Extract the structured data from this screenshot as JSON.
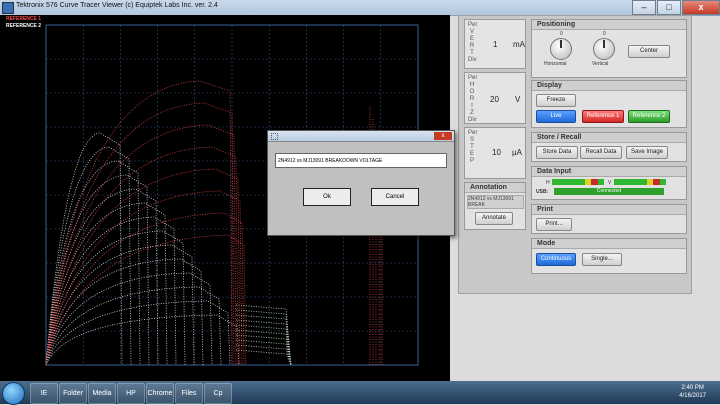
{
  "window": {
    "title": "Tektronix 576 Curve Tracer Viewer (c) Equiptek Labs Inc.  ver. 2.4",
    "minimize": "–",
    "maximize": "□",
    "close": "x"
  },
  "scope": {
    "reference1_label": "REFERENCE 1",
    "reference2_label": "REFERENCE 2"
  },
  "readouts": {
    "vert": {
      "label": "Per VERT Div",
      "letters": [
        "V",
        "E",
        "R",
        "T"
      ],
      "top": "Per",
      "bottom": "Div",
      "value": "1",
      "unit": "mA"
    },
    "horiz": {
      "label": "Per HORIZ Div",
      "letters": [
        "H",
        "O",
        "R",
        "I",
        "Z"
      ],
      "top": "Per",
      "bottom": "Div",
      "value": "20",
      "unit": "V"
    },
    "step": {
      "label": "Per STEP",
      "letters": [
        "S",
        "T",
        "E",
        "P"
      ],
      "top": "Per",
      "bottom": "",
      "value": "10",
      "unit": "µA"
    }
  },
  "annotation": {
    "header": "Annotation",
    "text": "2N4912 vs MJ13091 BREAK",
    "button": "Annotate"
  },
  "positioning": {
    "header": "Positioning",
    "horizontal_label": "Horizontal",
    "vertical_label": "Vertical",
    "horizontal_value": "0",
    "vertical_value": "0",
    "center_button": "Center"
  },
  "display": {
    "header": "Display",
    "freeze": "Freeze",
    "live": "Live",
    "reference1": "Reference 1",
    "reference2": "Reference 2"
  },
  "store_recall": {
    "header": "Store / Recall",
    "store": "Store Data",
    "recall": "Recall Data",
    "save": "Save Image"
  },
  "data_input": {
    "header": "Data Input",
    "h_label": "H",
    "v_label": "V",
    "usb_label": "USB:",
    "status": "Connected"
  },
  "print": {
    "header": "Print",
    "button": "Print..."
  },
  "mode": {
    "header": "Mode",
    "continuous": "Continuous",
    "single": "Single..."
  },
  "dialog": {
    "value": "2N4912 vs MJ13091 BREAKDOWN VOLTAGE",
    "ok": "Ok",
    "cancel": "Cancel"
  },
  "taskbar": {
    "time": "2:40 PM",
    "date": "4/16/2017",
    "items": [
      "IE",
      "Folder",
      "Media",
      "HP",
      "Chrome",
      "Files",
      "Cp"
    ]
  },
  "colors": {
    "ref1": "#ff4d4d",
    "ref2": "#ffffff",
    "grid": "#3a5f9a",
    "blue_button": "#2f7ee8",
    "red_button": "#e43a3a",
    "green_button": "#3dbb3d"
  }
}
